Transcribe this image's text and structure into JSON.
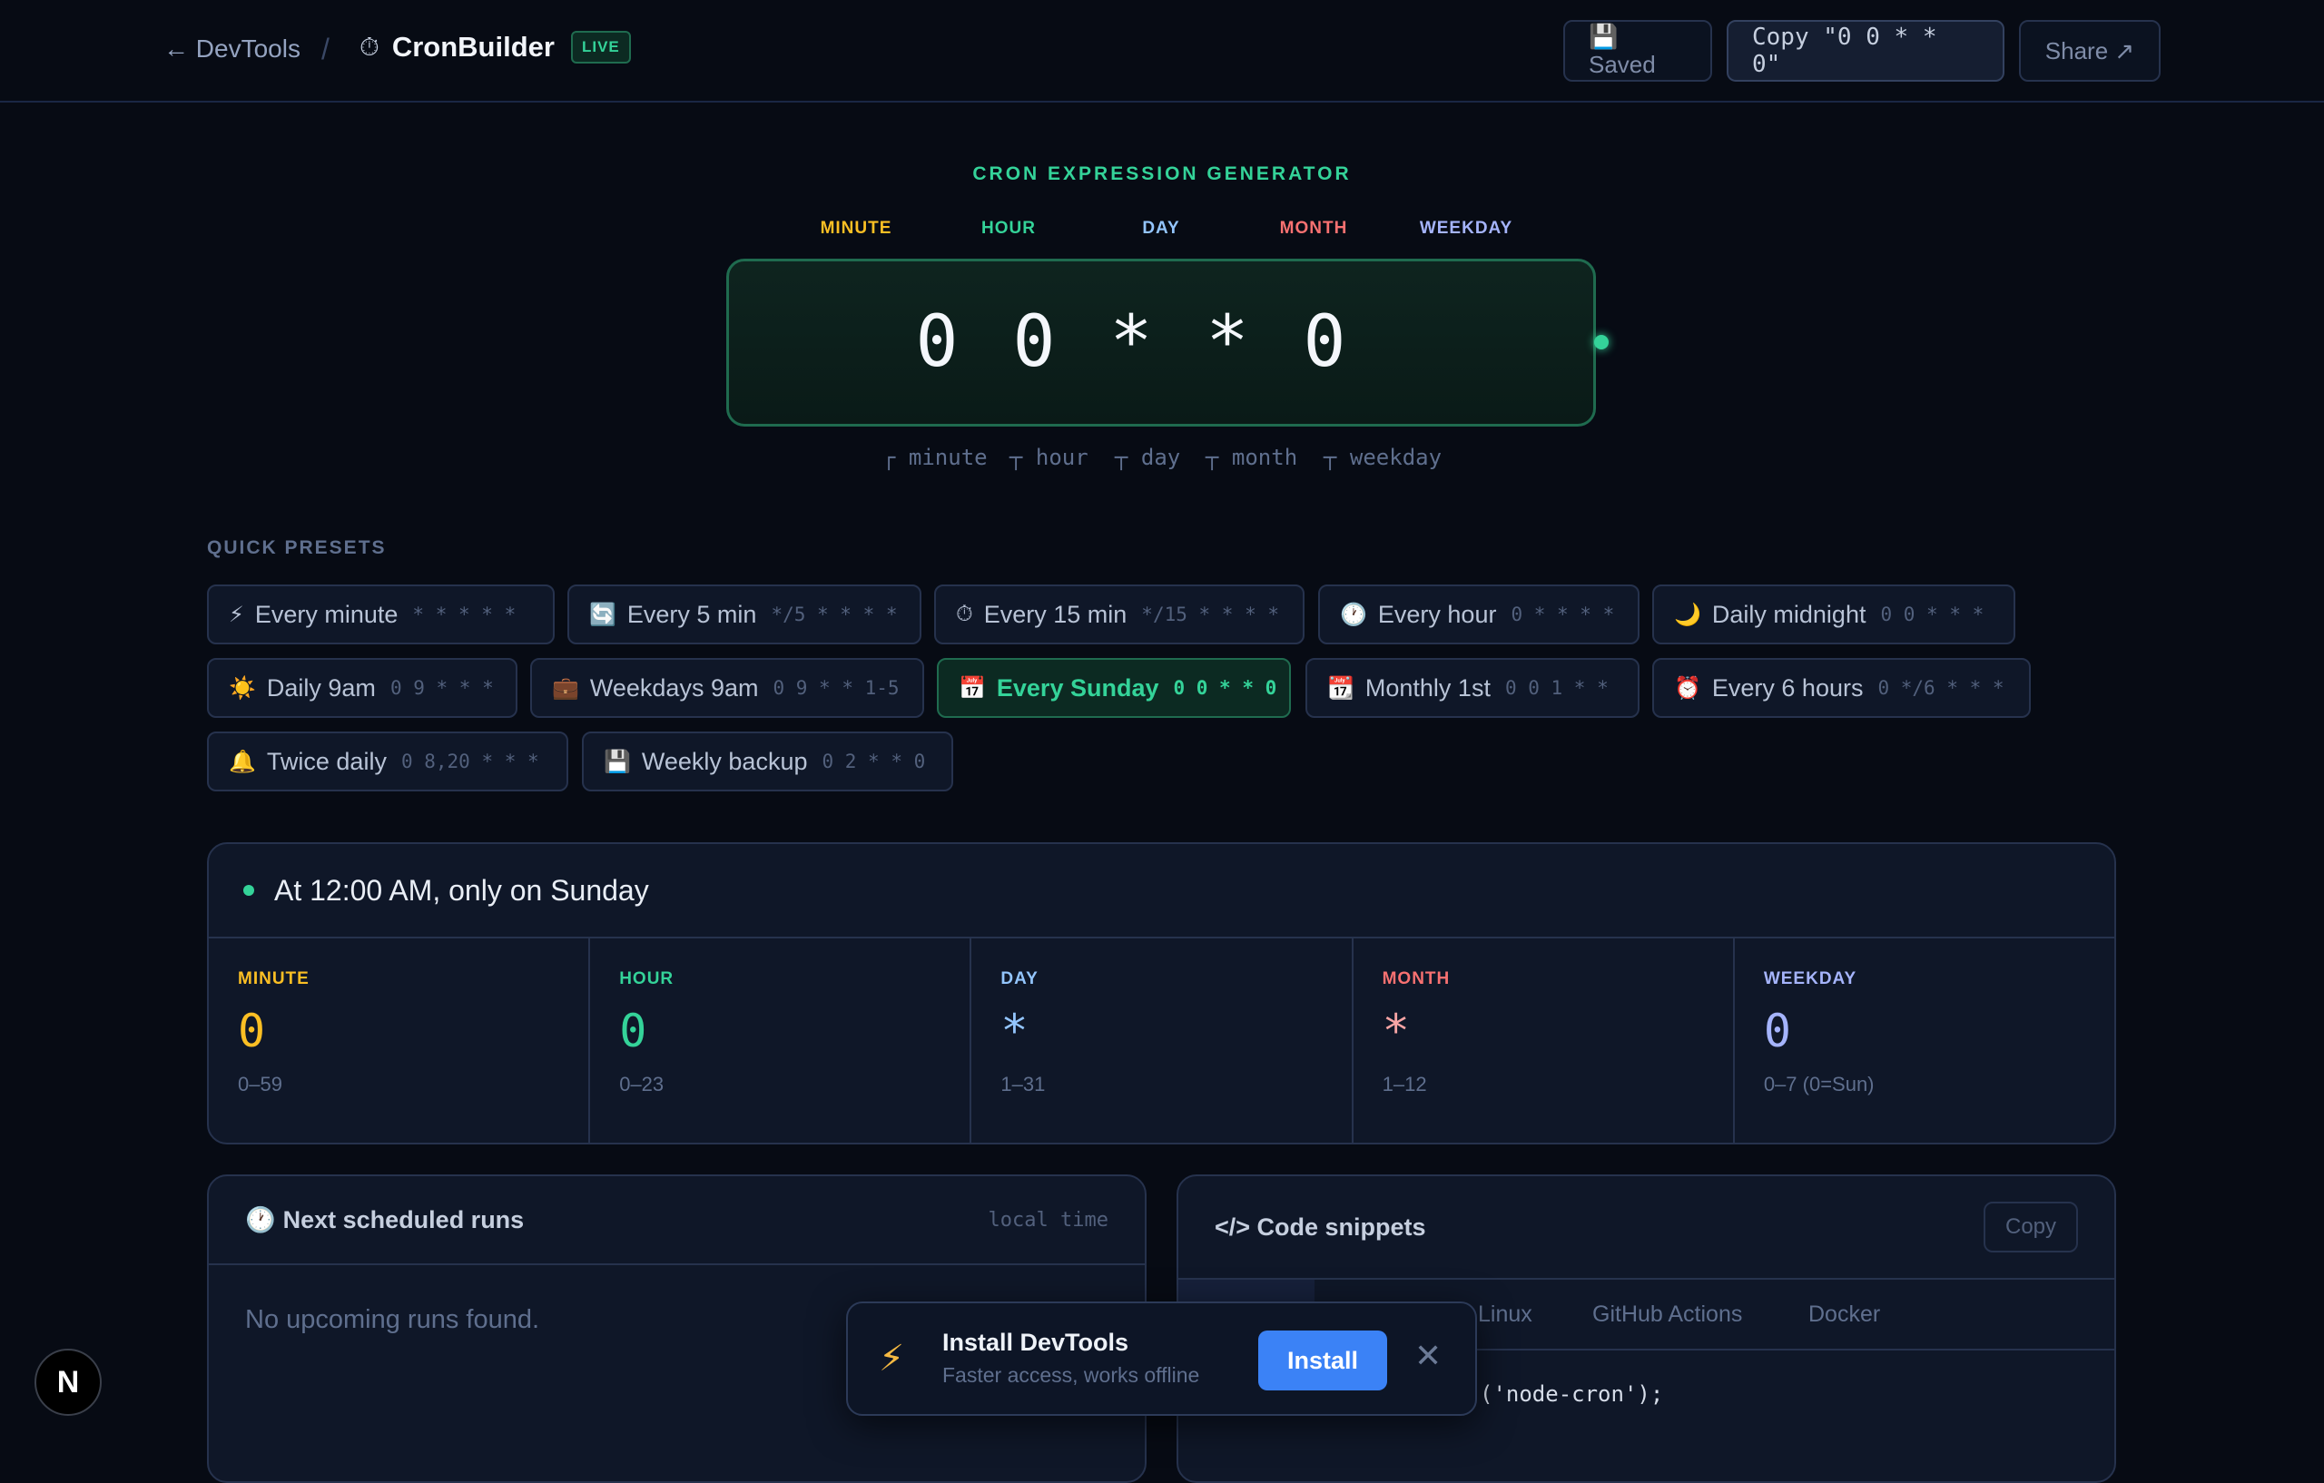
{
  "topbar": {
    "back_label": "← DevTools",
    "separator": "/",
    "app_icon": "⏱",
    "app_name": "CronBuilder",
    "live_badge": "LIVE",
    "saved_label": "💾 Saved",
    "copy_label": "Copy \"0 0 * * 0\"",
    "share_label": "Share ↗"
  },
  "generator": {
    "label": "CRON EXPRESSION GENERATOR",
    "field_labels": [
      "MINUTE",
      "HOUR",
      "DAY",
      "MONTH",
      "WEEKDAY"
    ],
    "tokens": [
      "0",
      "0",
      "*",
      "*",
      "0"
    ],
    "hints": [
      "┌ minute",
      "┬ hour",
      "┬ day",
      "┬ month",
      "┬ weekday"
    ]
  },
  "colors": {
    "minute": "#fbbf24",
    "hour": "#34d399",
    "day": "#93c5fd",
    "month": "#f87171",
    "weekday": "#a5b4fc",
    "accent": "#34d399",
    "install": "#3b82f6"
  },
  "presets": {
    "label": "QUICK PRESETS",
    "items": [
      {
        "icon": "⚡",
        "label": "Every minute",
        "expr": "* * * * *"
      },
      {
        "icon": "🔄",
        "label": "Every 5 min",
        "expr": "*/5 * * * *"
      },
      {
        "icon": "⏱",
        "label": "Every 15 min",
        "expr": "*/15 * * * *"
      },
      {
        "icon": "🕐",
        "label": "Every hour",
        "expr": "0 * * * *"
      },
      {
        "icon": "🌙",
        "label": "Daily midnight",
        "expr": "0 0 * * *"
      },
      {
        "icon": "☀️",
        "label": "Daily 9am",
        "expr": "0 9 * * *"
      },
      {
        "icon": "💼",
        "label": "Weekdays 9am",
        "expr": "0 9 * * 1-5"
      },
      {
        "icon": "📅",
        "label": "Every Sunday",
        "expr": "0 0 * * 0"
      },
      {
        "icon": "📆",
        "label": "Monthly 1st",
        "expr": "0 0 1 * *"
      },
      {
        "icon": "⏰",
        "label": "Every 6 hours",
        "expr": "0 */6 * * *"
      },
      {
        "icon": "🔔",
        "label": "Twice daily",
        "expr": "0 8,20 * * *"
      },
      {
        "icon": "💾",
        "label": "Weekly backup",
        "expr": "0 2 * * 0"
      }
    ]
  },
  "description": {
    "text": "At 12:00 AM, only on Sunday",
    "fields": [
      {
        "label": "MINUTE",
        "value": "0",
        "range": "0–59"
      },
      {
        "label": "HOUR",
        "value": "0",
        "range": "0–23"
      },
      {
        "label": "DAY",
        "value": "*",
        "range": "1–31"
      },
      {
        "label": "MONTH",
        "value": "*",
        "range": "1–12"
      },
      {
        "label": "WEEKDAY",
        "value": "0",
        "range": "0–7 (0=Sun)"
      }
    ]
  },
  "runs": {
    "icon": "🕐",
    "title": "Next scheduled runs",
    "timezone": "local time",
    "empty": "No upcoming runs found."
  },
  "code": {
    "title": "</> Code snippets",
    "copy_label": "Copy",
    "tabs": [
      "Linux",
      "GitHub Actions",
      "Docker"
    ],
    "line": "('node-cron');"
  },
  "toast": {
    "icon": "⚡",
    "title": "Install DevTools",
    "subtitle": "Faster access, works offline",
    "install_label": "Install",
    "close_icon": "✕"
  },
  "badge": {
    "label": "N"
  }
}
